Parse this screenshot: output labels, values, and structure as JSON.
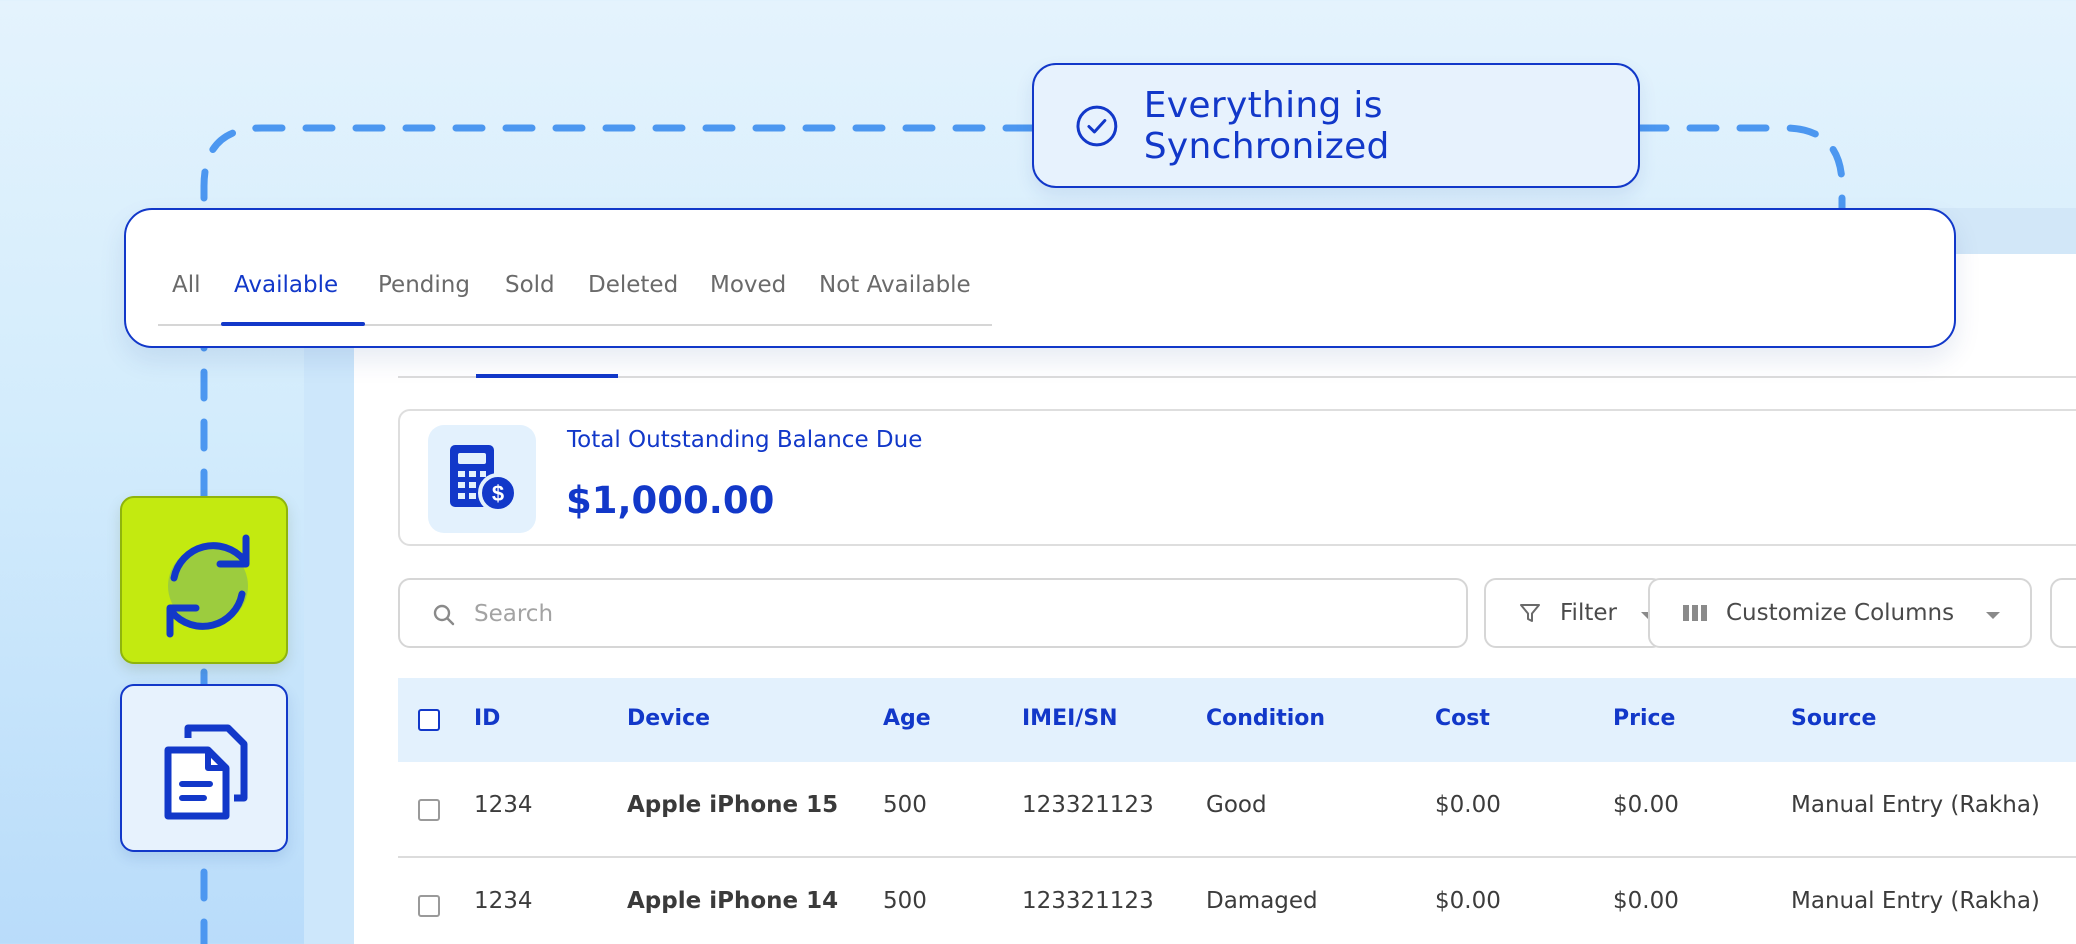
{
  "sync_toast": {
    "message": "Everything is Synchronized"
  },
  "tabs": [
    {
      "label": "All",
      "active": false
    },
    {
      "label": "Available",
      "active": true
    },
    {
      "label": "Pending",
      "active": false
    },
    {
      "label": "Sold",
      "active": false
    },
    {
      "label": "Deleted",
      "active": false
    },
    {
      "label": "Moved",
      "active": false
    },
    {
      "label": "Not Available",
      "active": false
    }
  ],
  "side_actions": [
    {
      "icon": "sync-icon",
      "accent": "#c3ea10"
    },
    {
      "icon": "documents-icon",
      "accent": "#e7f2fd"
    }
  ],
  "balance": {
    "label": "Total Outstanding Balance Due",
    "amount": "$1,000.00",
    "icon": "calculator-dollar-icon"
  },
  "toolbar": {
    "search_placeholder": "Search",
    "filter_label": "Filter",
    "columns_label": "Customize Columns"
  },
  "table": {
    "columns": [
      "ID",
      "Device",
      "Age",
      "IMEI/SN",
      "Condition",
      "Cost",
      "Price",
      "Source"
    ],
    "rows": [
      {
        "id": "1234",
        "device": "Apple iPhone 15",
        "age": "500",
        "imei": "123321123",
        "condition": "Good",
        "cost": "$0.00",
        "price": "$0.00",
        "source": "Manual Entry (Rakha)"
      },
      {
        "id": "1234",
        "device": "Apple iPhone 14",
        "age": "500",
        "imei": "123321123",
        "condition": "Damaged",
        "cost": "$0.00",
        "price": "$0.00",
        "source": "Manual Entry (Rakha)"
      }
    ]
  },
  "colors": {
    "primary": "#1238c9",
    "accent_dashed": "#4c97f0",
    "sync_tile": "#c3ea10",
    "header_bg": "#e3f1fd"
  }
}
